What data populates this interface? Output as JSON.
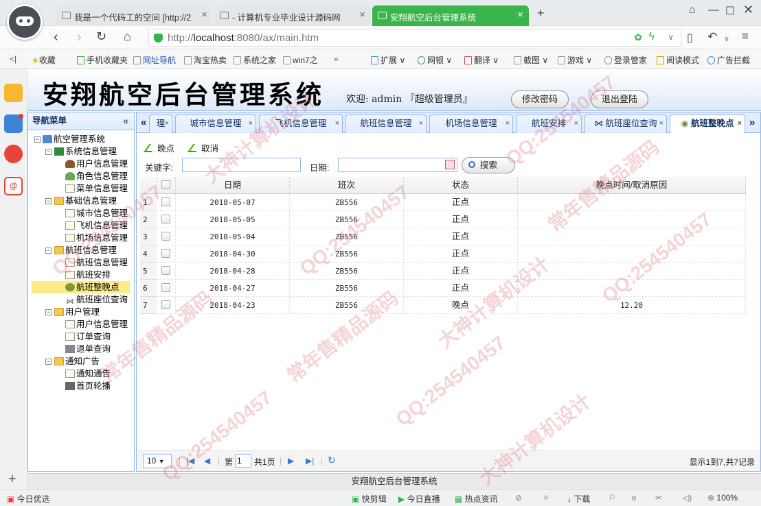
{
  "browser": {
    "tabs": [
      {
        "title": "我是一个代码工的空间 [http://2",
        "active": false
      },
      {
        "title": "- 计算机专业毕业设计源码网",
        "active": false
      },
      {
        "title": "安翔航空后台管理系统",
        "active": true
      }
    ],
    "new_tab_label": "+",
    "url_prefix": "http://",
    "url_host": "localhost",
    "url_rest": ":8080/ax/main.htm",
    "bookmarks": [
      "收藏",
      "手机收藏夹",
      "网址导航",
      "淘宝热卖",
      "系统之家",
      "win7之",
      "扩展",
      "网银",
      "翻译",
      "截图",
      "游戏",
      "登录管家",
      "阅读模式",
      "广告拦截"
    ]
  },
  "header": {
    "title": "安翔航空后台管理系统",
    "welcome": "欢迎: admin 『超级管理员』",
    "change_password": "修改密码",
    "logout": "退出登陆"
  },
  "nav": {
    "title": "导航菜单",
    "collapse_glyph": "«",
    "root": "航空管理系统",
    "groups": [
      {
        "label": "系统信息管理",
        "items": [
          "用户信息管理",
          "角色信息管理",
          "菜单信息管理"
        ]
      },
      {
        "label": "基础信息管理",
        "items": [
          "城市信息管理",
          "飞机信息管理",
          "机场信息管理"
        ]
      },
      {
        "label": "航班信息管理",
        "items": [
          "航班信息管理",
          "航班安排",
          "航班整晚点",
          "航班座位查询"
        ]
      },
      {
        "label": "用户管理",
        "items": [
          "用户信息管理",
          "订单查询",
          "退单查询"
        ]
      },
      {
        "label": "通知广告",
        "items": [
          "通知通告",
          "首页轮播"
        ]
      }
    ],
    "selected": "航班整晚点"
  },
  "tabs": [
    {
      "label": "理"
    },
    {
      "label": "城市信息管理"
    },
    {
      "label": "飞机信息管理"
    },
    {
      "label": "航班信息管理"
    },
    {
      "label": "机场信息管理"
    },
    {
      "label": "航班安排"
    },
    {
      "label": "航班座位查询"
    },
    {
      "label": "航班整晚点",
      "active": true
    }
  ],
  "toolbar": {
    "delay": "晚点",
    "cancel": "取消"
  },
  "search": {
    "keyword_label": "关键字:",
    "keyword_value": "",
    "date_label": "日期:",
    "date_value": "",
    "button": "搜索"
  },
  "grid": {
    "columns": [
      "日期",
      "班次",
      "状态",
      "晚点时间/取消原因"
    ],
    "rows": [
      {
        "n": "1",
        "date": "2018-05-07",
        "flight": "ZB556",
        "status": "正点",
        "reason": ""
      },
      {
        "n": "2",
        "date": "2018-05-05",
        "flight": "ZB556",
        "status": "正点",
        "reason": ""
      },
      {
        "n": "3",
        "date": "2018-05-04",
        "flight": "ZB556",
        "status": "正点",
        "reason": ""
      },
      {
        "n": "4",
        "date": "2018-04-30",
        "flight": "ZB556",
        "status": "正点",
        "reason": ""
      },
      {
        "n": "5",
        "date": "2018-04-28",
        "flight": "ZB556",
        "status": "正点",
        "reason": ""
      },
      {
        "n": "6",
        "date": "2018-04-27",
        "flight": "ZB556",
        "status": "正点",
        "reason": ""
      },
      {
        "n": "7",
        "date": "2018-04-23",
        "flight": "ZB556",
        "status": "晚点",
        "reason": "12.20"
      }
    ]
  },
  "pager": {
    "page_size": "10",
    "page_prefix": "第",
    "page_value": "1",
    "page_total": "共1页",
    "display_info": "显示1到7,共7记录"
  },
  "footer": "安翔航空后台管理系统",
  "statusbar": [
    "今日优选",
    "快剪辑",
    "今日直播",
    "热点资讯",
    "下载",
    "100%"
  ],
  "watermark": [
    "QQ:254540457",
    "大神计算机设计",
    "常年售精品源码"
  ]
}
